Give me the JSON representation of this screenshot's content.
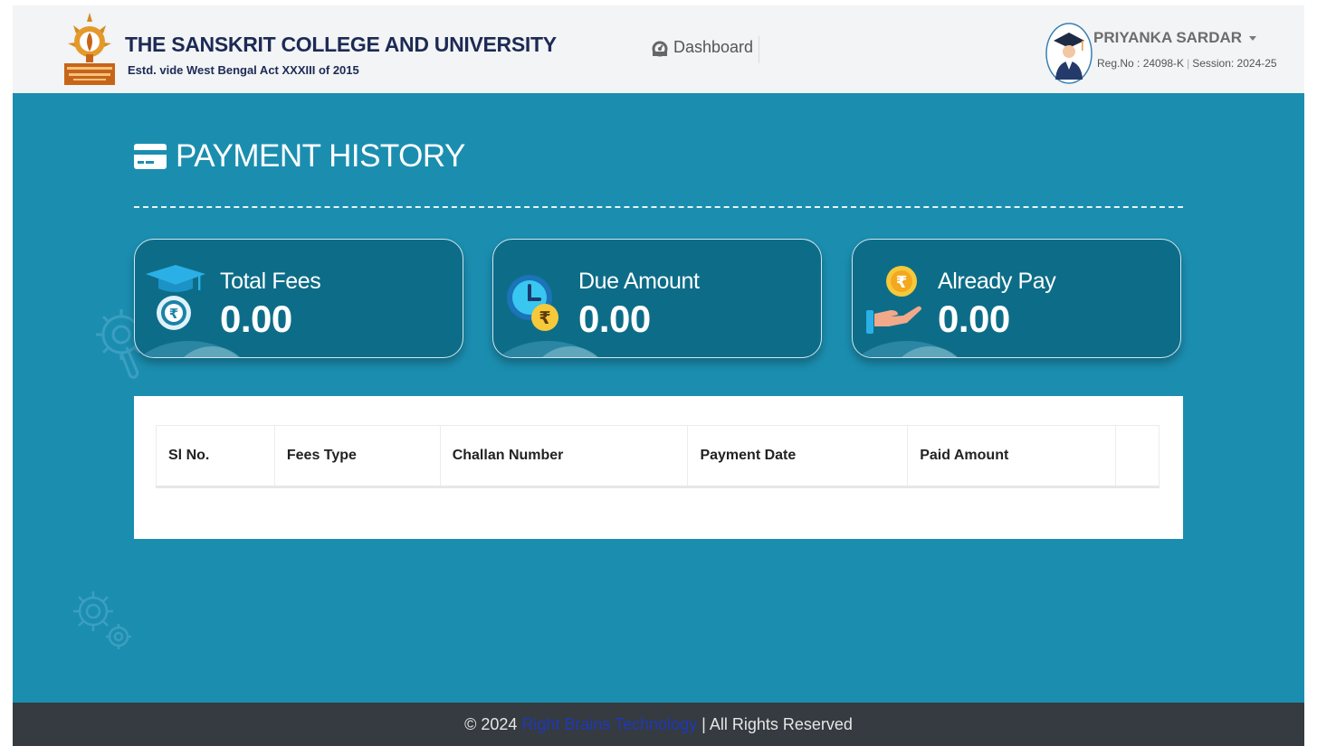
{
  "header": {
    "college_name": "THE SANSKRIT COLLEGE AND UNIVERSITY",
    "college_subtitle": "Estd. vide West Bengal Act XXXIII of 2015",
    "nav_dashboard": "Dashboard",
    "user": {
      "name": "PRIYANKA SARDAR",
      "reg_no": "Reg.No : 24098-K",
      "session": "Session: 2024-25"
    }
  },
  "page": {
    "title": "PAYMENT HISTORY"
  },
  "cards": [
    {
      "label": "Total Fees",
      "value": "0.00",
      "icon": "graduation-cap-rupee-icon"
    },
    {
      "label": "Due Amount",
      "value": "0.00",
      "icon": "clock-rupee-icon"
    },
    {
      "label": "Already Pay",
      "value": "0.00",
      "icon": "hand-rupee-icon"
    }
  ],
  "table": {
    "columns": [
      "Sl No.",
      "Fees Type",
      "Challan Number",
      "Payment Date",
      "Paid Amount",
      ""
    ],
    "rows": []
  },
  "footer": {
    "prefix": "© 2024",
    "brand": "Right Brains Technology",
    "suffix": "| All Rights Reserved"
  },
  "colors": {
    "page_background": "#1b8eb0",
    "card_background": "#0d6d88",
    "header_background": "#f2f4f5",
    "footer_background": "#353b40",
    "brand_link": "#1f38b8"
  }
}
